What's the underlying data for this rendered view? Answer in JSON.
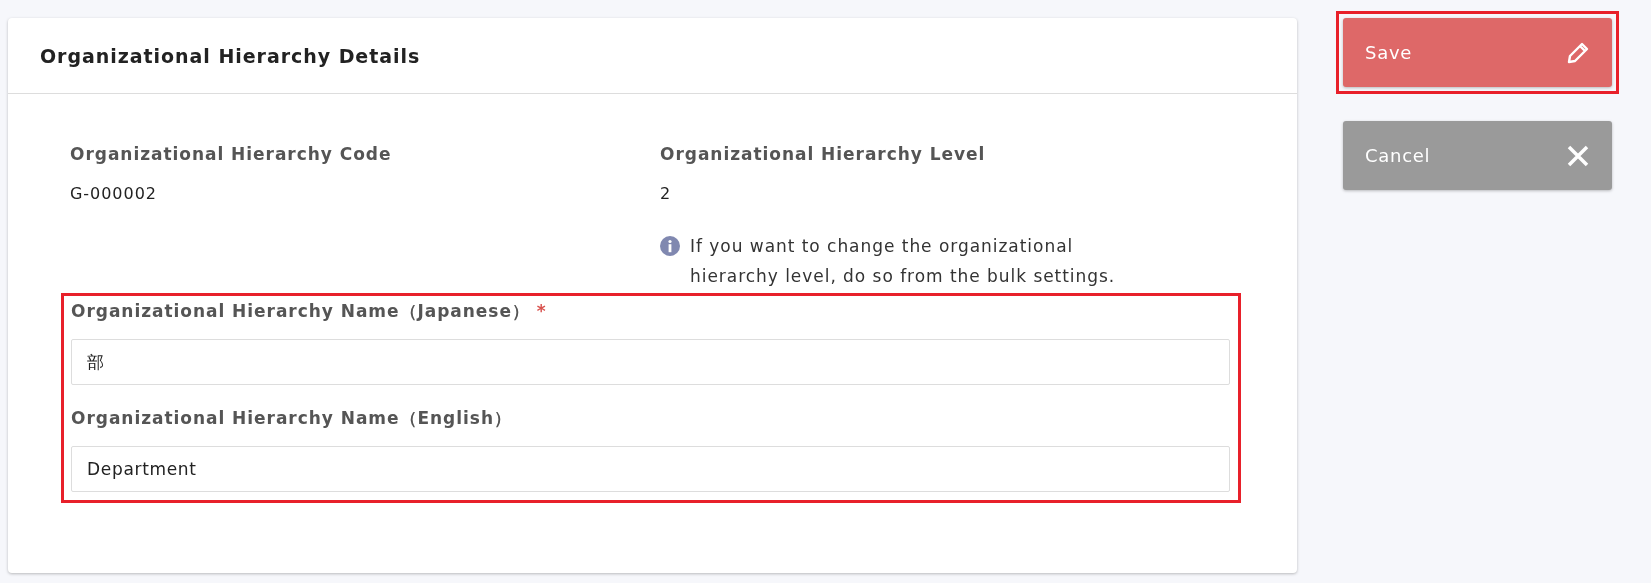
{
  "card": {
    "title": "Organizational Hierarchy Details",
    "info_fields": [
      {
        "label": "Organizational Hierarchy Code",
        "value": "G-000002"
      },
      {
        "label": "Organizational Hierarchy Level",
        "value": "2",
        "note": "If you want to change the organizational hierarchy level, do so from the bulk settings."
      }
    ],
    "name_fields": {
      "highlighted": true,
      "fields": [
        {
          "label": "Organizational Hierarchy Name（Japanese）",
          "required": true,
          "value": "部"
        },
        {
          "label": "Organizational Hierarchy Name（English）",
          "required": false,
          "value": "Department"
        }
      ]
    }
  },
  "actions": [
    {
      "kind": "save",
      "label": "Save",
      "highlighted": true
    },
    {
      "kind": "cancel",
      "label": "Cancel",
      "highlighted": false
    }
  ],
  "required_mark": "*"
}
